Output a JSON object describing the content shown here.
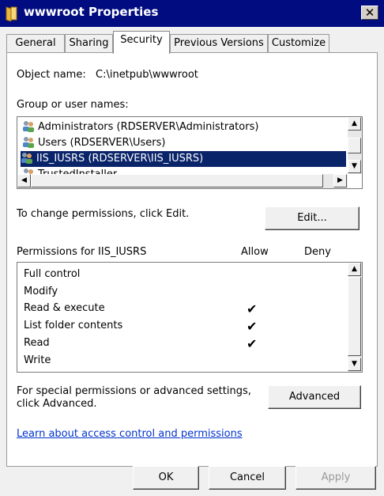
{
  "window": {
    "title": "wwwroot Properties",
    "close_label": "✕"
  },
  "tabs": [
    {
      "label": "General"
    },
    {
      "label": "Sharing"
    },
    {
      "label": "Security"
    },
    {
      "label": "Previous Versions"
    },
    {
      "label": "Customize"
    }
  ],
  "security": {
    "object_name_label": "Object name:",
    "object_name_value": "C:\\inetpub\\wwwroot",
    "group_label": "Group or user names:",
    "users": [
      {
        "name": "Administrators (RDSERVER\\Administrators)",
        "icon": "users-group-icon"
      },
      {
        "name": "Users (RDSERVER\\Users)",
        "icon": "users-group-icon"
      },
      {
        "name": "IIS_IUSRS (RDSERVER\\IIS_IUSRS)",
        "icon": "users-group-icon",
        "selected": true
      },
      {
        "name": "TrustedInstaller",
        "icon": "users-group-icon"
      }
    ],
    "change_text": "To change permissions, click Edit.",
    "edit_label": "Edit...",
    "permissions_for": "Permissions for IIS_IUSRS",
    "allow_header": "Allow",
    "deny_header": "Deny",
    "permissions": [
      {
        "name": "Full control",
        "allow": false
      },
      {
        "name": "Modify",
        "allow": false
      },
      {
        "name": "Read & execute",
        "allow": true
      },
      {
        "name": "List folder contents",
        "allow": true
      },
      {
        "name": "Read",
        "allow": true
      },
      {
        "name": "Write",
        "allow": false
      }
    ],
    "advanced_text": "For special permissions or advanced settings,\nclick Advanced.",
    "advanced_label": "Advanced",
    "learn_link": "Learn about access control and permissions",
    "check_glyph": "✔"
  },
  "footer": {
    "ok": "OK",
    "cancel": "Cancel",
    "apply": "Apply"
  }
}
